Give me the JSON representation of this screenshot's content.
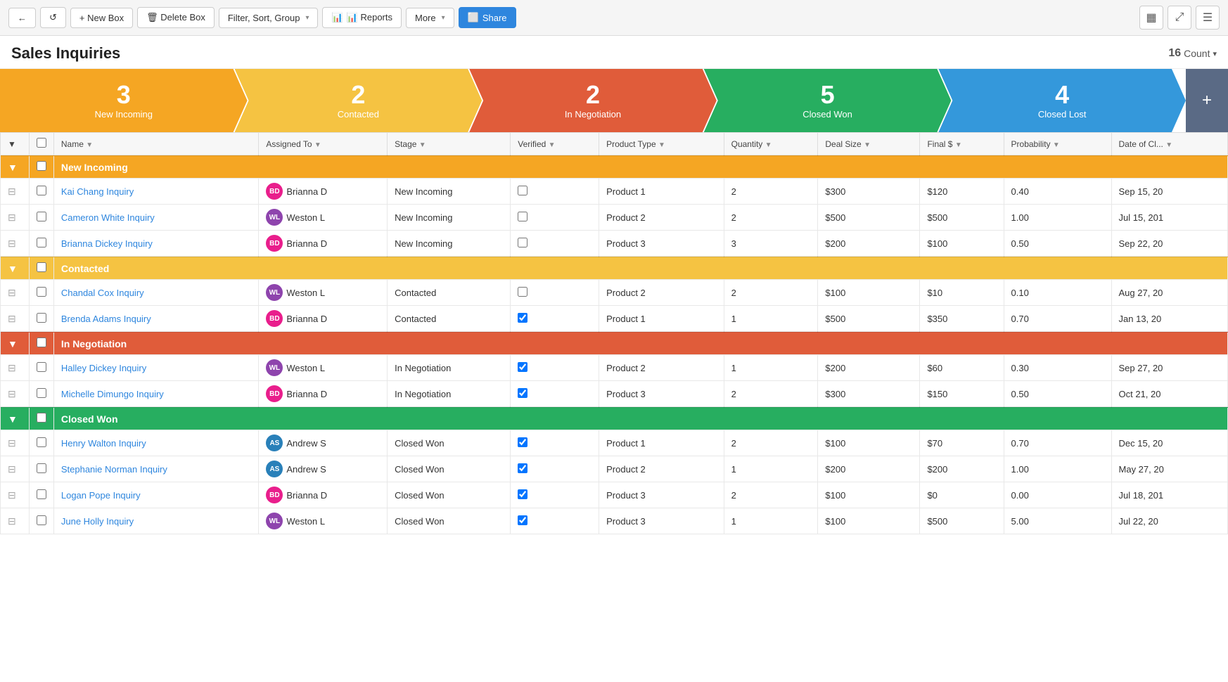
{
  "toolbar": {
    "back_label": "←",
    "refresh_label": "↺",
    "new_box_label": "+ New Box",
    "delete_box_label": "🗑 Delete Box",
    "filter_sort_label": "Filter, Sort, Group",
    "reports_label": "📊 Reports",
    "more_label": "More",
    "share_label": "Share",
    "view_icon1": "▦",
    "view_icon2": "⤢",
    "view_icon3": "☰"
  },
  "page": {
    "title": "Sales Inquiries",
    "count": "16",
    "count_label": "Count"
  },
  "pipeline_stages": [
    {
      "id": "new-incoming",
      "label": "New Incoming",
      "count": "3",
      "color": "#f5a623"
    },
    {
      "id": "contacted",
      "label": "Contacted",
      "count": "2",
      "color": "#f5c342"
    },
    {
      "id": "in-negotiation",
      "label": "In Negotiation",
      "count": "2",
      "color": "#e05c3a"
    },
    {
      "id": "closed-won",
      "label": "Closed Won",
      "count": "5",
      "color": "#27ae60"
    },
    {
      "id": "closed-lost",
      "label": "Closed Lost",
      "count": "4",
      "color": "#3498db"
    }
  ],
  "columns": [
    {
      "id": "handle",
      "label": ""
    },
    {
      "id": "checkbox",
      "label": ""
    },
    {
      "id": "name",
      "label": "Name"
    },
    {
      "id": "assigned",
      "label": "Assigned To"
    },
    {
      "id": "stage",
      "label": "Stage"
    },
    {
      "id": "verified",
      "label": "Verified"
    },
    {
      "id": "product_type",
      "label": "Product Type"
    },
    {
      "id": "quantity",
      "label": "Quantity"
    },
    {
      "id": "deal_size",
      "label": "Deal Size"
    },
    {
      "id": "final_dollar",
      "label": "Final $"
    },
    {
      "id": "probability",
      "label": "Probability"
    },
    {
      "id": "date_closed",
      "label": "Date of Cl..."
    }
  ],
  "groups": [
    {
      "id": "new-incoming",
      "label": "New Incoming",
      "color_class": "group-new-incoming",
      "rows": [
        {
          "name": "Kai Chang Inquiry",
          "assigned": "Brianna D",
          "assigned_color": "#e91e8c",
          "stage": "New Incoming",
          "verified": false,
          "product_type": "Product 1",
          "quantity": "2",
          "deal_size": "$300",
          "final": "$120",
          "probability": "0.40",
          "date": "Sep 15, 20"
        },
        {
          "name": "Cameron White Inquiry",
          "assigned": "Weston L",
          "assigned_color": "#8e44ad",
          "stage": "New Incoming",
          "verified": false,
          "product_type": "Product 2",
          "quantity": "2",
          "deal_size": "$500",
          "final": "$500",
          "probability": "1.00",
          "date": "Jul 15, 201"
        },
        {
          "name": "Brianna Dickey Inquiry",
          "assigned": "Brianna D",
          "assigned_color": "#e91e8c",
          "stage": "New Incoming",
          "verified": false,
          "product_type": "Product 3",
          "quantity": "3",
          "deal_size": "$200",
          "final": "$100",
          "probability": "0.50",
          "date": "Sep 22, 20"
        }
      ]
    },
    {
      "id": "contacted",
      "label": "Contacted",
      "color_class": "group-contacted",
      "rows": [
        {
          "name": "Chandal Cox Inquiry",
          "assigned": "Weston L",
          "assigned_color": "#8e44ad",
          "stage": "Contacted",
          "verified": false,
          "product_type": "Product 2",
          "quantity": "2",
          "deal_size": "$100",
          "final": "$10",
          "probability": "0.10",
          "date": "Aug 27, 20"
        },
        {
          "name": "Brenda Adams Inquiry",
          "assigned": "Brianna D",
          "assigned_color": "#e91e8c",
          "stage": "Contacted",
          "verified": true,
          "product_type": "Product 1",
          "quantity": "1",
          "deal_size": "$500",
          "final": "$350",
          "probability": "0.70",
          "date": "Jan 13, 20"
        }
      ]
    },
    {
      "id": "in-negotiation",
      "label": "In Negotiation",
      "color_class": "group-in-negotiation",
      "rows": [
        {
          "name": "Halley Dickey Inquiry",
          "assigned": "Weston L",
          "assigned_color": "#8e44ad",
          "stage": "In Negotiation",
          "verified": true,
          "product_type": "Product 2",
          "quantity": "1",
          "deal_size": "$200",
          "final": "$60",
          "probability": "0.30",
          "date": "Sep 27, 20"
        },
        {
          "name": "Michelle Dimungo Inquiry",
          "assigned": "Brianna D",
          "assigned_color": "#e91e8c",
          "stage": "In Negotiation",
          "verified": true,
          "product_type": "Product 3",
          "quantity": "2",
          "deal_size": "$300",
          "final": "$150",
          "probability": "0.50",
          "date": "Oct 21, 20"
        }
      ]
    },
    {
      "id": "closed-won",
      "label": "Closed Won",
      "color_class": "group-closed-won",
      "rows": [
        {
          "name": "Henry Walton Inquiry",
          "assigned": "Andrew S",
          "assigned_color": "#2980b9",
          "stage": "Closed Won",
          "verified": true,
          "product_type": "Product 1",
          "quantity": "2",
          "deal_size": "$100",
          "final": "$70",
          "probability": "0.70",
          "date": "Dec 15, 20"
        },
        {
          "name": "Stephanie Norman Inquiry",
          "assigned": "Andrew S",
          "assigned_color": "#2980b9",
          "stage": "Closed Won",
          "verified": true,
          "product_type": "Product 2",
          "quantity": "1",
          "deal_size": "$200",
          "final": "$200",
          "probability": "1.00",
          "date": "May 27, 20"
        },
        {
          "name": "Logan Pope Inquiry",
          "assigned": "Brianna D",
          "assigned_color": "#e91e8c",
          "stage": "Closed Won",
          "verified": true,
          "product_type": "Product 3",
          "quantity": "2",
          "deal_size": "$100",
          "final": "$0",
          "probability": "0.00",
          "date": "Jul 18, 201"
        },
        {
          "name": "June Holly Inquiry",
          "assigned": "Weston L",
          "assigned_color": "#8e44ad",
          "stage": "Closed Won",
          "verified": true,
          "product_type": "Product 3",
          "quantity": "1",
          "deal_size": "$100",
          "final": "$500",
          "probability": "5.00",
          "date": "Jul 22, 20"
        }
      ]
    }
  ]
}
